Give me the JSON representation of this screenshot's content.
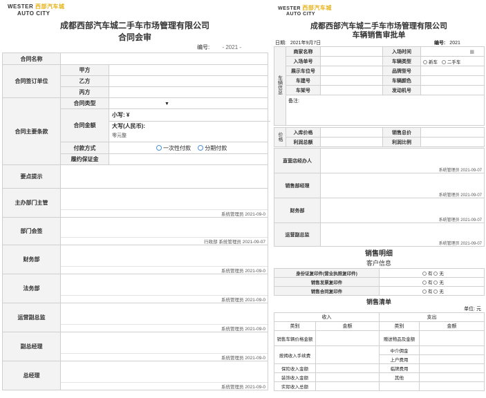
{
  "left": {
    "logo_en1": "WESTER",
    "logo_cn": "西部汽车城",
    "logo_en2": "AUTO CITY",
    "company": "成都西部汽车城二手车市场管理有限公司",
    "form_title": "合同会审",
    "number_label": "编号:",
    "number_value": "- 2021 -",
    "rows": {
      "contract_name": "合同名称",
      "parties": "合同签订单位",
      "party_a": "甲方",
      "party_b": "乙方",
      "party_c": "丙方",
      "main_terms": "合同主要条款",
      "contract_type": "合同类型",
      "contract_amount": "合同金额",
      "amount_small": "小写: ¥",
      "amount_big": "大写(人民币):",
      "amount_big_value": "零元整",
      "payment_method": "付款方式",
      "pay_once": "一次性付款",
      "pay_installments": "分期付款",
      "deposit": "履约保证金",
      "key_points": "要点提示",
      "dept_head": "主办部门主管",
      "dept_sign": "部门会签",
      "finance": "财务部",
      "legal": "法务部",
      "ops_vp": "运营副总监",
      "vice_gm": "副总经理",
      "gm": "总经理"
    },
    "sig_dept_head": "系统管理员  2021-09-0",
    "sig_dept_sign": "行政部    系统管理员    2021-09-07",
    "sig_finance": "系统管理员  2021-09-0",
    "sig_legal": "系统管理员  2021-09-0",
    "sig_ops": "系统管理员  2021-09-0",
    "sig_vgm": "系统管理员  2021-09-0",
    "sig_gm": "系统管理员  2021-09-0"
  },
  "right": {
    "logo_en1": "WESTER",
    "logo_cn": "西部汽车城",
    "logo_en2": "AUTO CITY",
    "company": "成都西部汽车城二手车市场管理有限公司",
    "form_title": "车辆销售审批单",
    "date_label": "日期:",
    "date_value": "2021年9月7日",
    "number_label": "编号:",
    "number_value": "2021",
    "vehicle_info": "车辆信息",
    "price_label": "价格",
    "fields": {
      "dealer_name": "商家名称",
      "in_time": "入场时间",
      "in_no": "入场单号",
      "vehicle_type": "车辆类型",
      "new_car": "新车",
      "used_car": "二手车",
      "display_no": "展示车位号",
      "brand_model": "品牌型号",
      "vehicle_key": "车建号",
      "vehicle_color": "车辆颜色",
      "frame_no": "车架号",
      "engine_no": "发动机号",
      "remark": "备注:",
      "in_price": "入库价格",
      "total_price": "销售总价",
      "total_profit": "利润总额",
      "profit_ratio": "利润比例",
      "director": "直营店经办人",
      "sales_mgr": "销售部经理",
      "finance": "财务部",
      "ops_vp": "运营副总监"
    },
    "sig_director": "系统管理员  2021-09-07",
    "sig_sales": "系统管理员  2021-09-07",
    "sig_finance": "系统管理员  2021-09-07",
    "sig_ops": "系统管理员  2021-09-07",
    "sales_detail": "销售明细",
    "customer_info": "客户信息",
    "id_copy": "身份证复印件(营业执照复印件)",
    "invoice_copy": "销售发票复印件",
    "contract_copy": "销售合同复印件",
    "yes": "有",
    "no": "无",
    "sales_list": "销售清单",
    "unit": "单位: 元",
    "income": "收入",
    "expense": "支出",
    "category": "类别",
    "amount": "金额",
    "income_items": [
      "销售车辆价格金额",
      "按揭收入手续费",
      "保险收入金额",
      "装饰收入金额",
      "实际收入总额"
    ],
    "expense_items": [
      "赠送物品及金额",
      "中介佣金",
      "上户费用",
      "临牌费用",
      "其他"
    ]
  }
}
